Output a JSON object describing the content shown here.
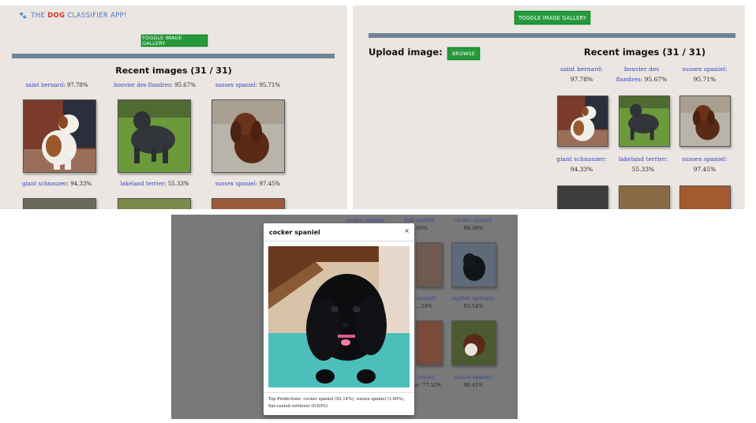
{
  "left_panel": {
    "brand": {
      "prefix": "THE",
      "dog": "DOG",
      "suffix": "CLASSIFIER APP!"
    },
    "toggle_label": "TOGGLE IMAGE GALLERY",
    "heading": "Recent images (31 / 31)",
    "items": [
      {
        "name": "saint bernard",
        "pct": "97.78%"
      },
      {
        "name": "bouvier des flandres",
        "pct": "95.67%"
      },
      {
        "name": "sussex spaniel",
        "pct": "95.71%"
      },
      {
        "name": "giant schnauzer",
        "pct": "94.33%"
      },
      {
        "name": "lakeland terrier",
        "pct": "55.33%"
      },
      {
        "name": "sussex spaniel",
        "pct": "97.45%"
      }
    ]
  },
  "right_panel": {
    "toggle_label": "TOGGLE IMAGE GALLERY",
    "upload_label": "Upload image:",
    "browse_label": "BROWSE",
    "heading": "Recent images (31 / 31)",
    "items": [
      {
        "name_line1": "saint bernard:",
        "name_line2": "",
        "pct": "97.78%"
      },
      {
        "name_line1": "bouvier des",
        "name_line2": "flandres:",
        "pct": "95.67%"
      },
      {
        "name_line1": "sussex spaniel:",
        "name_line2": "",
        "pct": "95.71%"
      },
      {
        "name_line1": "giant schnauzer:",
        "name_line2": "",
        "pct": "94.33%"
      },
      {
        "name_line1": "lakeland terrier:",
        "name_line2": "",
        "pct": "55.33%"
      },
      {
        "name_line1": "sussex spaniel:",
        "name_line2": "",
        "pct": "97.45%"
      }
    ]
  },
  "modal": {
    "title": "cocker spaniel",
    "close": "×",
    "predictions": "Top Predictions: cocker spaniel (93.14%), sussex spaniel (1.60%), flat-coated retriever (0.83%)"
  },
  "background_captions": [
    {
      "name": "cocker spaniel:",
      "pct": ""
    },
    {
      "name": "bull mastiff:",
      "pct": "...60%"
    },
    {
      "name": "cocker spaniel:",
      "pct": "88.36%"
    },
    {
      "name": "...mastiff:",
      "pct": "...18%"
    },
    {
      "name": "english springer:",
      "pct": "83.54%"
    },
    {
      "name": "...coated",
      "pct": "...ver: 77.52%"
    },
    {
      "name": "sussex spaniel:",
      "pct": "90.41%"
    }
  ]
}
